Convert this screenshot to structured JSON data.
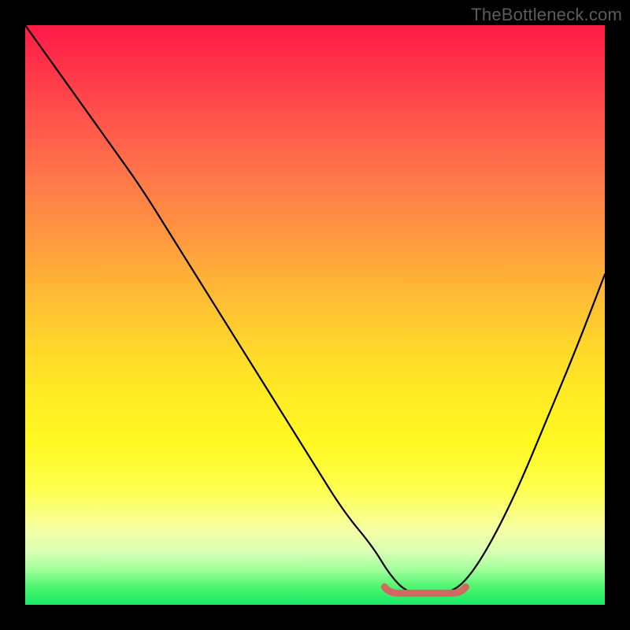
{
  "watermark": "TheBottleneck.com",
  "colors": {
    "background": "#000000",
    "curve_stroke": "#000000",
    "marker_stroke": "#cf6a63",
    "watermark_text": "#5c5c5c"
  },
  "chart_data": {
    "type": "line",
    "title": "",
    "xlabel": "",
    "ylabel": "",
    "xlim": [
      0,
      100
    ],
    "ylim": [
      0,
      100
    ],
    "grid": false,
    "legend": false,
    "background_gradient": "red-yellow-green vertical (bottleneck severity)",
    "series": [
      {
        "name": "bottleneck-curve",
        "x": [
          0,
          5,
          10,
          15,
          20,
          25,
          30,
          35,
          40,
          45,
          50,
          55,
          60,
          63,
          66,
          70,
          73,
          76,
          80,
          85,
          90,
          95,
          100
        ],
        "y": [
          100,
          93,
          86,
          79,
          72,
          64,
          56,
          48,
          40,
          32,
          24,
          16,
          10,
          5,
          2,
          2,
          2,
          4,
          10,
          20,
          32,
          44,
          57
        ]
      }
    ],
    "marker": {
      "name": "optimal-flat-region",
      "x_range": [
        62,
        76
      ],
      "y": 2
    }
  }
}
